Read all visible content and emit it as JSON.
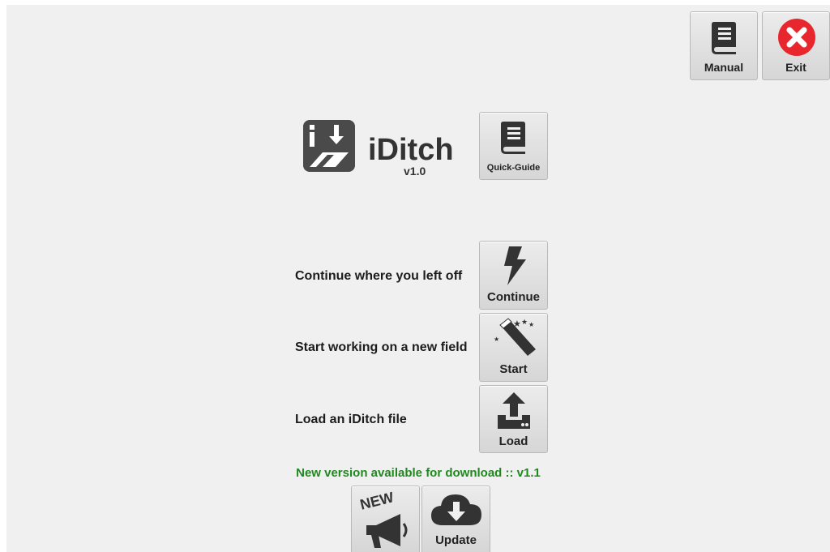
{
  "app": {
    "name": "iDitch",
    "version": "v1.0"
  },
  "top": {
    "manual_label": "Manual",
    "exit_label": "Exit"
  },
  "guide": {
    "label": "Quick-Guide"
  },
  "actions": {
    "continue": {
      "description": "Continue where you left off",
      "button": "Continue",
      "icon": "lightning-bolt-icon"
    },
    "start": {
      "description": "Start working on a new field",
      "button": "Start",
      "icon": "magic-wand-icon"
    },
    "load": {
      "description": "Load an iDitch file",
      "button": "Load",
      "icon": "upload-icon"
    }
  },
  "update": {
    "notice": "New version available for download :: v1.1",
    "new_badge": "NEW",
    "update_label": "Update"
  },
  "colors": {
    "exit_red": "#e8262e",
    "notice_green": "#1e8a1e",
    "icon_dark": "#333333"
  }
}
